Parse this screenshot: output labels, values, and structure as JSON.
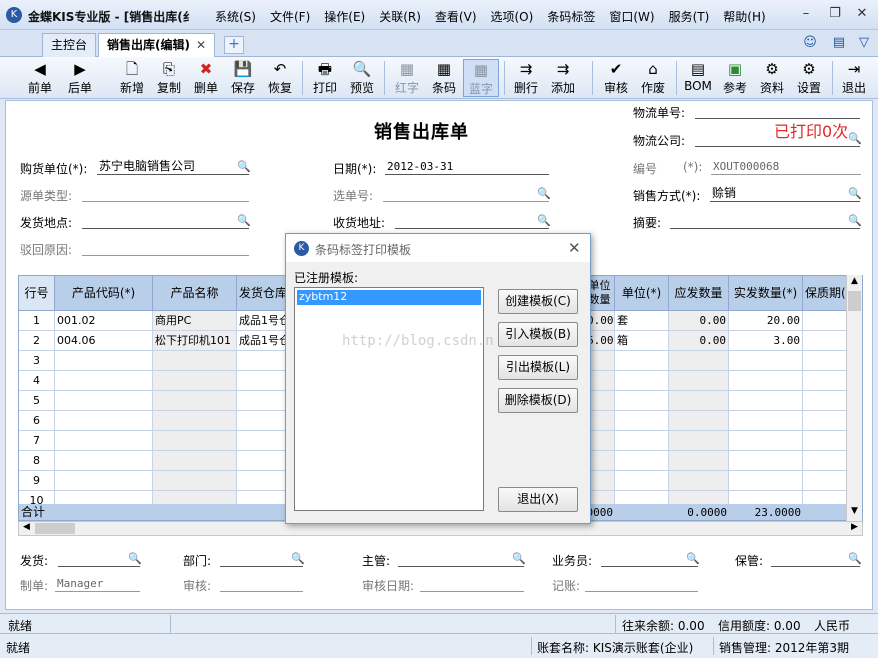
{
  "app": {
    "title": "金蝶KIS专业版 - [销售出库(纟"
  },
  "menu": [
    "系统(S)",
    "文件(F)",
    "操作(E)",
    "关联(R)",
    "查看(V)",
    "选项(O)",
    "条码标签",
    "窗口(W)",
    "服务(T)",
    "帮助(H)"
  ],
  "tabs": [
    {
      "label": "主控台"
    },
    {
      "label": "销售出库(编辑)"
    }
  ],
  "toolbar": [
    {
      "label": "前单",
      "icon": "◀"
    },
    {
      "label": "后单",
      "icon": "▶"
    },
    {
      "label": "新增",
      "icon": "🗋"
    },
    {
      "label": "复制",
      "icon": "⎘"
    },
    {
      "label": "删单",
      "icon": "✖"
    },
    {
      "label": "保存",
      "icon": "💾"
    },
    {
      "label": "恢复",
      "icon": "↶"
    },
    {
      "label": "打印",
      "icon": "🖶"
    },
    {
      "label": "预览",
      "icon": "🔍"
    },
    {
      "label": "红字",
      "icon": "▦"
    },
    {
      "label": "条码",
      "icon": "▦"
    },
    {
      "label": "蓝字",
      "icon": "▦"
    },
    {
      "label": "删行",
      "icon": "⇉"
    },
    {
      "label": "添加",
      "icon": "⇉"
    },
    {
      "label": "审核",
      "icon": "✔"
    },
    {
      "label": "作废",
      "icon": "⌂"
    },
    {
      "label": "BOM",
      "icon": "▤"
    },
    {
      "label": "参考",
      "icon": "▣"
    },
    {
      "label": "资料",
      "icon": "⚙"
    },
    {
      "label": "设置",
      "icon": "⚙"
    },
    {
      "label": "退出",
      "icon": "⇥"
    }
  ],
  "form": {
    "title": "销售出库单",
    "printed_status": "已打印0次",
    "logistics_no_label": "物流单号:",
    "logistics_co_label": "物流公司:",
    "buyer_label": "购货单位(*):",
    "buyer_value": "苏宁电脑销售公司",
    "date_label": "日期(*):",
    "date_value": "2012-03-31",
    "code_label": "编号",
    "code_req": "(*):",
    "code_value": "XOUT000068",
    "source_type_label": "源单类型:",
    "select_no_label": "选单号:",
    "sale_method_label": "销售方式(*):",
    "sale_method_value": "赊销",
    "ship_place_label": "发货地点:",
    "recv_addr_label": "收货地址:",
    "summary_label": "摘要:",
    "reject_reason_label": "驳回原因:"
  },
  "grid": {
    "headers": [
      "行号",
      "产品代码(*)",
      "产品名称",
      "发货仓库",
      "单位数量",
      "单位(*)",
      "应发数量",
      "实发数量(*)",
      "保质期("
    ],
    "rows": [
      {
        "idx": "1",
        "code": "001.02",
        "name": "商用PC",
        "wh": "成品1号仓",
        "unitq": "0.00",
        "unit": "套",
        "due": "0.00",
        "actual": "20.00"
      },
      {
        "idx": "2",
        "code": "004.06",
        "name": "松下打印机101",
        "wh": "成品1号仓",
        "unitq": "6.00",
        "unit": "箱",
        "due": "0.00",
        "actual": "3.00"
      },
      {
        "idx": "3"
      },
      {
        "idx": "4"
      },
      {
        "idx": "5"
      },
      {
        "idx": "6"
      },
      {
        "idx": "7"
      },
      {
        "idx": "8"
      },
      {
        "idx": "9"
      },
      {
        "idx": "10"
      }
    ],
    "total_label": "合计",
    "total_unitq": "0000",
    "total_due": "0.0000",
    "total_actual": "23.0000"
  },
  "footer": {
    "ship_label": "发货:",
    "dept_label": "部门:",
    "manager_label": "主管:",
    "sales_label": "业务员:",
    "keeper_label": "保管:",
    "maker_label": "制单:",
    "maker_value": "Manager",
    "audit_label": "审核:",
    "audit_date_label": "审核日期:",
    "booking_label": "记账:"
  },
  "status": {
    "ready1": "就绪",
    "balance": "往来余额: 0.00",
    "credit": "信用额度: 0.00",
    "currency": "人民币",
    "ready2": "就绪",
    "account": "账套名称: KIS演示账套(企业)",
    "period": "销售管理: 2012年第3期"
  },
  "dialog": {
    "title": "条码标签打印模板",
    "list_label": "已注册模板:",
    "selected_item": "zybtm12",
    "btn_create": "创建模板(C)",
    "btn_import": "引入模板(B)",
    "btn_export": "引出模板(L)",
    "btn_delete": "删除模板(D)",
    "btn_exit": "退出(X)"
  },
  "watermark": "http://blog.csdn.n"
}
